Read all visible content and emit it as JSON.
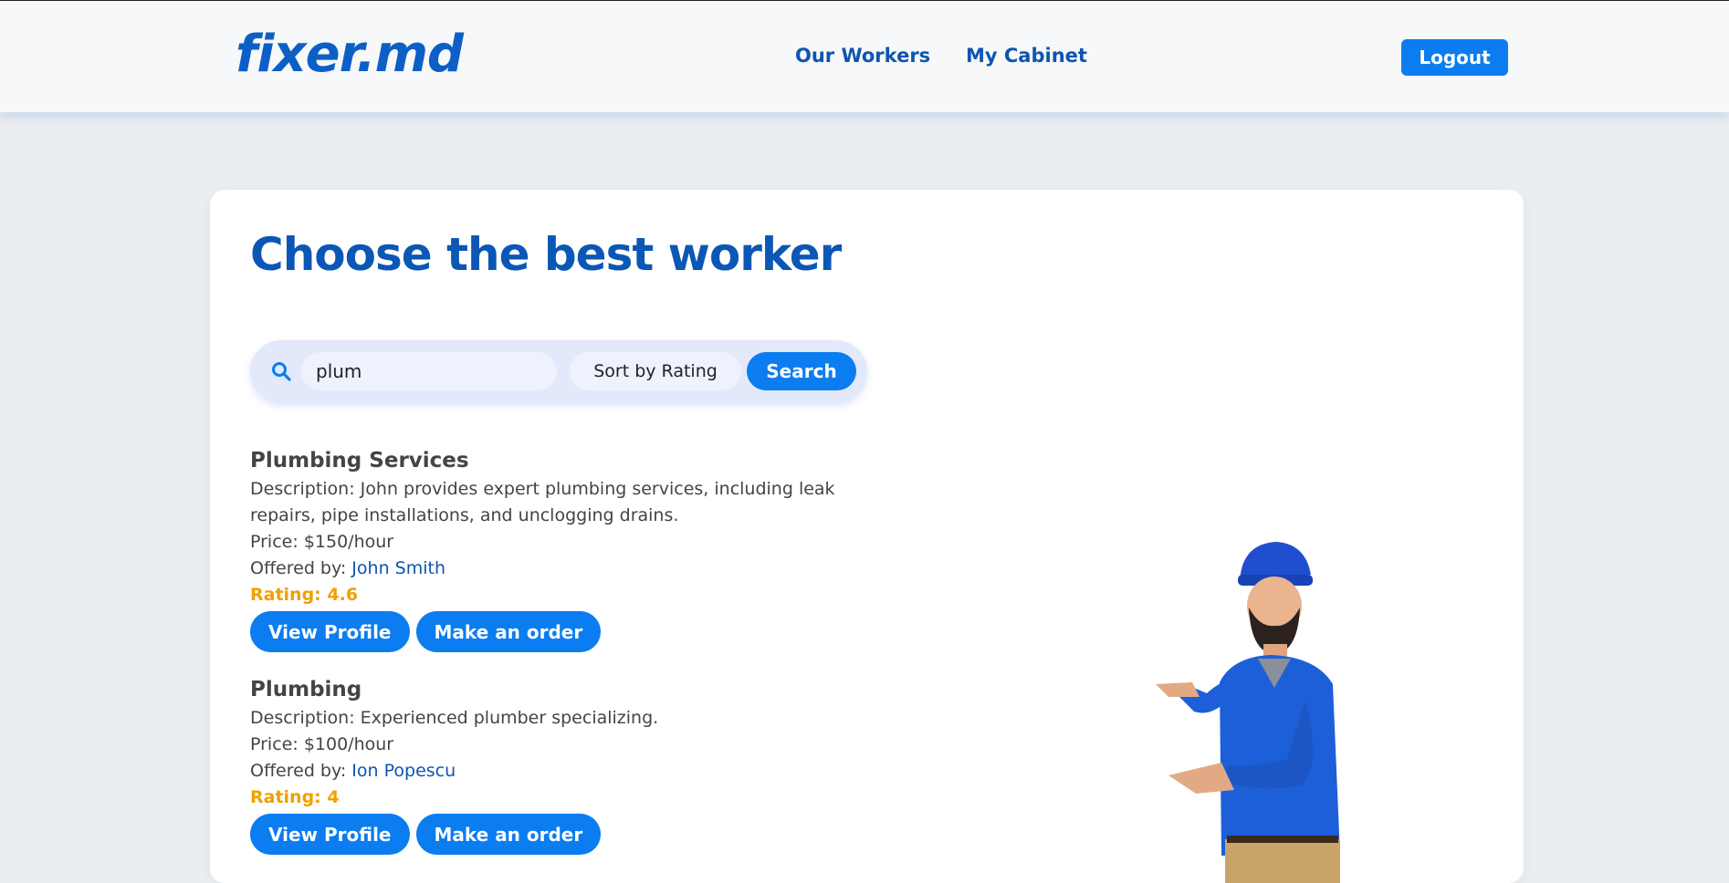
{
  "header": {
    "logo": "fixer.md",
    "nav": {
      "our_workers": "Our Workers",
      "my_cabinet": "My Cabinet"
    },
    "logout_label": "Logout"
  },
  "main": {
    "title": "Choose the best worker",
    "search": {
      "value": "plum",
      "sort_selected": "Sort by Rating",
      "button_label": "Search"
    },
    "listings": [
      {
        "title": "Plumbing Services",
        "description_label": "Description:",
        "description": "John provides expert plumbing services, including leak repairs, pipe installations, and unclogging drains.",
        "price_label": "Price:",
        "price": "$150/hour",
        "offered_by_label": "Offered by:",
        "worker": "John Smith",
        "rating_label": "Rating:",
        "rating": "4.6",
        "view_profile_label": "View Profile",
        "order_label": "Make an order"
      },
      {
        "title": "Plumbing",
        "description_label": "Description:",
        "description": "Experienced plumber specializing.",
        "price_label": "Price:",
        "price": "$100/hour",
        "offered_by_label": "Offered by:",
        "worker": "Ion Popescu",
        "rating_label": "Rating:",
        "rating": "4",
        "view_profile_label": "View Profile",
        "order_label": "Make an order"
      }
    ]
  },
  "colors": {
    "brand_blue": "#0b57b5",
    "button_blue": "#0b7df0",
    "rating_orange": "#f0a000",
    "page_background": "#ebeef0"
  },
  "icons": {
    "search": "search-icon"
  }
}
